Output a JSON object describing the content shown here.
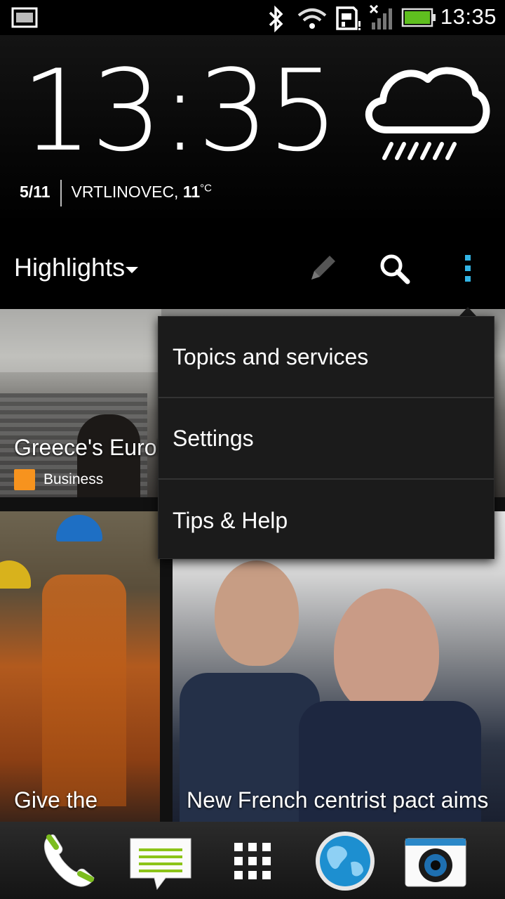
{
  "status_bar": {
    "time": "13:35",
    "icons": [
      "screenshot-icon",
      "bluetooth-icon",
      "wifi-icon",
      "sim-card-icon",
      "signal-icon",
      "battery-icon"
    ]
  },
  "widget": {
    "time": "13:35",
    "date": "5/11",
    "location": "VRTLINOVEC,",
    "temperature": "11",
    "temperature_unit": "°C",
    "weather_icon": "rain-cloud-icon"
  },
  "action_bar": {
    "title": "Highlights",
    "accent": "#33b5e5"
  },
  "feed": {
    "tiles": [
      {
        "caption": "Greece's Eurob",
        "source": "Business"
      },
      {
        "caption": "Give the"
      },
      {
        "caption": "New French centrist pact aims"
      }
    ]
  },
  "menu": {
    "items": [
      "Topics and services",
      "Settings",
      "Tips & Help"
    ]
  },
  "dock": {
    "icons": [
      "phone-icon",
      "messages-icon",
      "all-apps-icon",
      "browser-globe-icon",
      "camera-icon"
    ]
  }
}
